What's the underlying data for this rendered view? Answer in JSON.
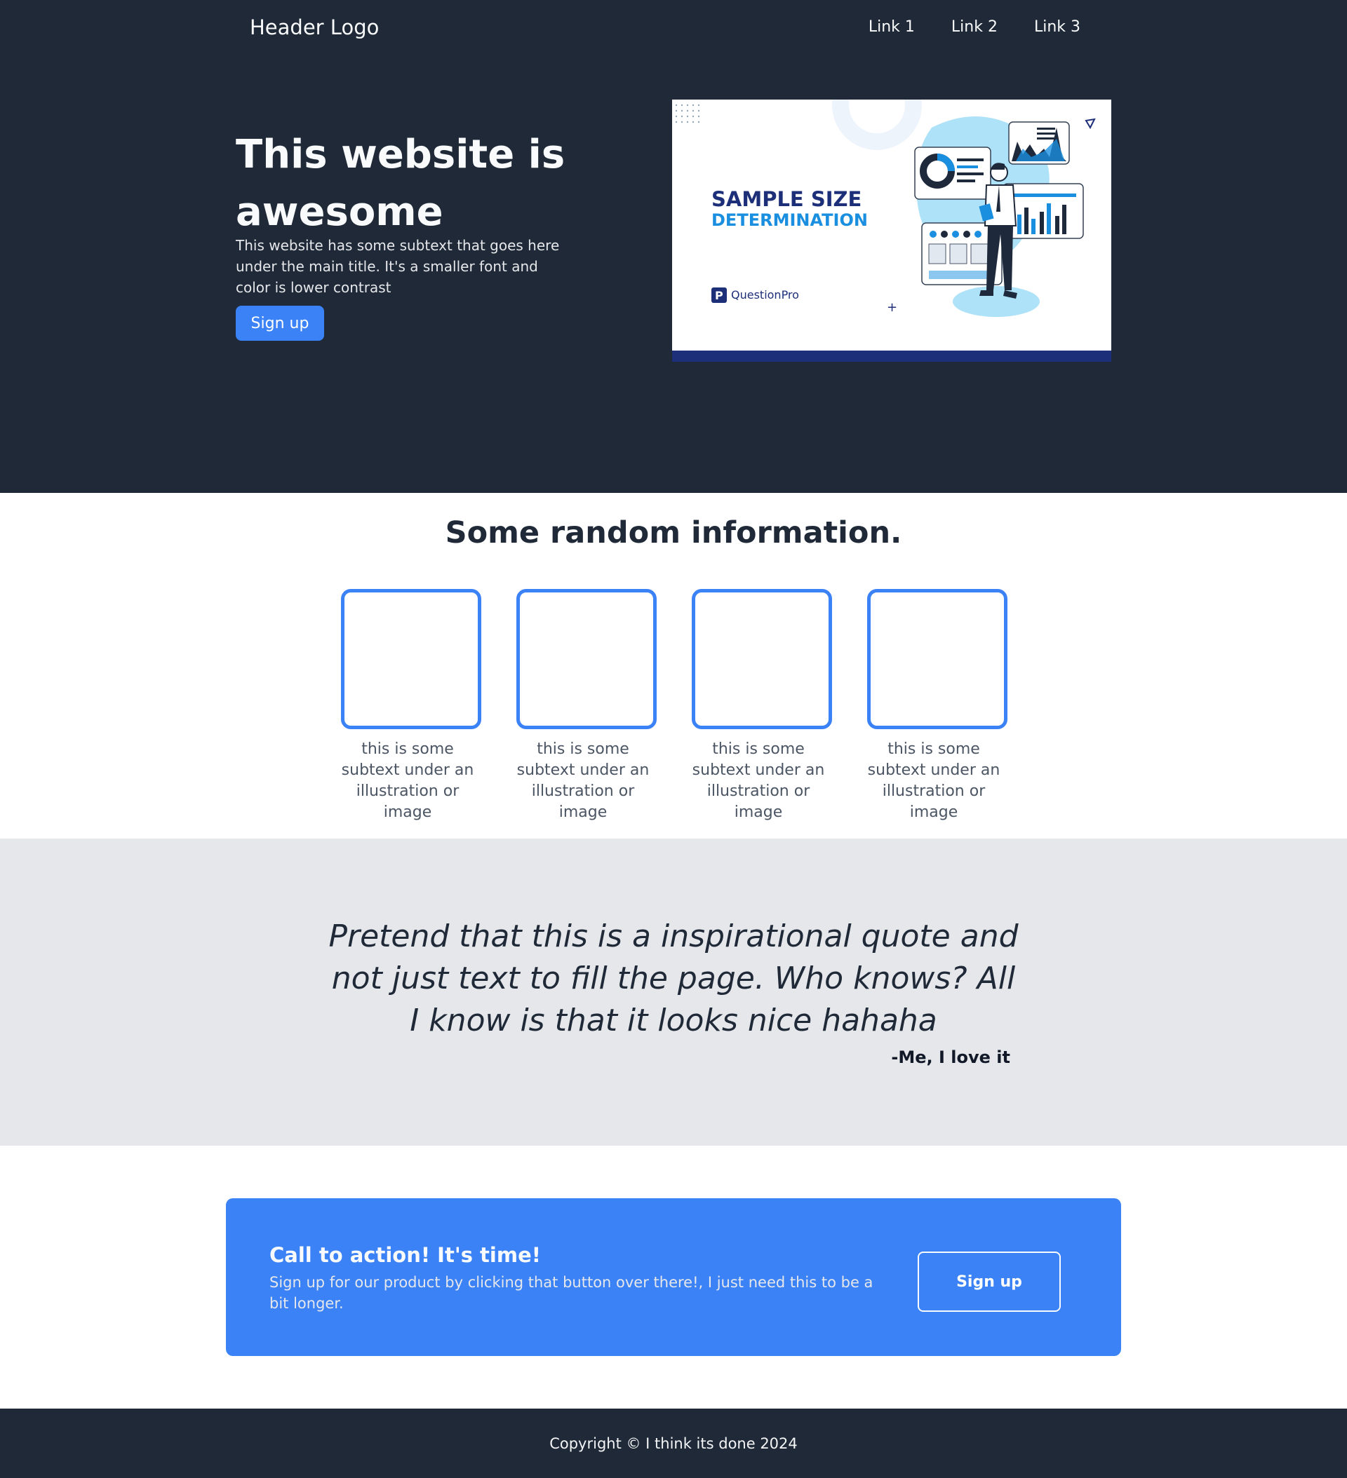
{
  "header": {
    "logo": "Header Logo",
    "links": [
      "Link 1",
      "Link 2",
      "Link 3"
    ]
  },
  "hero": {
    "title": "This website is awesome",
    "subtitle": "This website has some subtext that goes here under the main title. It's a smaller font and color is lower contrast",
    "button_label": "Sign up",
    "image": {
      "title_line1": "SAMPLE SIZE",
      "title_line2": "DETERMINATION",
      "brand": "QuestionPro"
    }
  },
  "info": {
    "title": "Some random information.",
    "cards": [
      {
        "text": "this is some subtext under an illustration or image"
      },
      {
        "text": "this is some subtext under an illustration or image"
      },
      {
        "text": "this is some subtext under an illustration or image"
      },
      {
        "text": "this is some subtext under an illustration or image"
      }
    ]
  },
  "quote": {
    "text": "Pretend that this is a inspirational quote and not just text to fill the page. Who knows? All I know is that it looks nice hahaha",
    "author": "-Me, I love it"
  },
  "cta": {
    "title": "Call to action! It's time!",
    "text": "Sign up for our product by clicking that button over there!, I just need this to be a bit longer.",
    "button_label": "Sign up"
  },
  "footer": {
    "text": "Copyright © I think its done 2024"
  },
  "colors": {
    "dark": "#1f2937",
    "accent": "#3b82f6",
    "light_gray": "#e5e7eb"
  }
}
